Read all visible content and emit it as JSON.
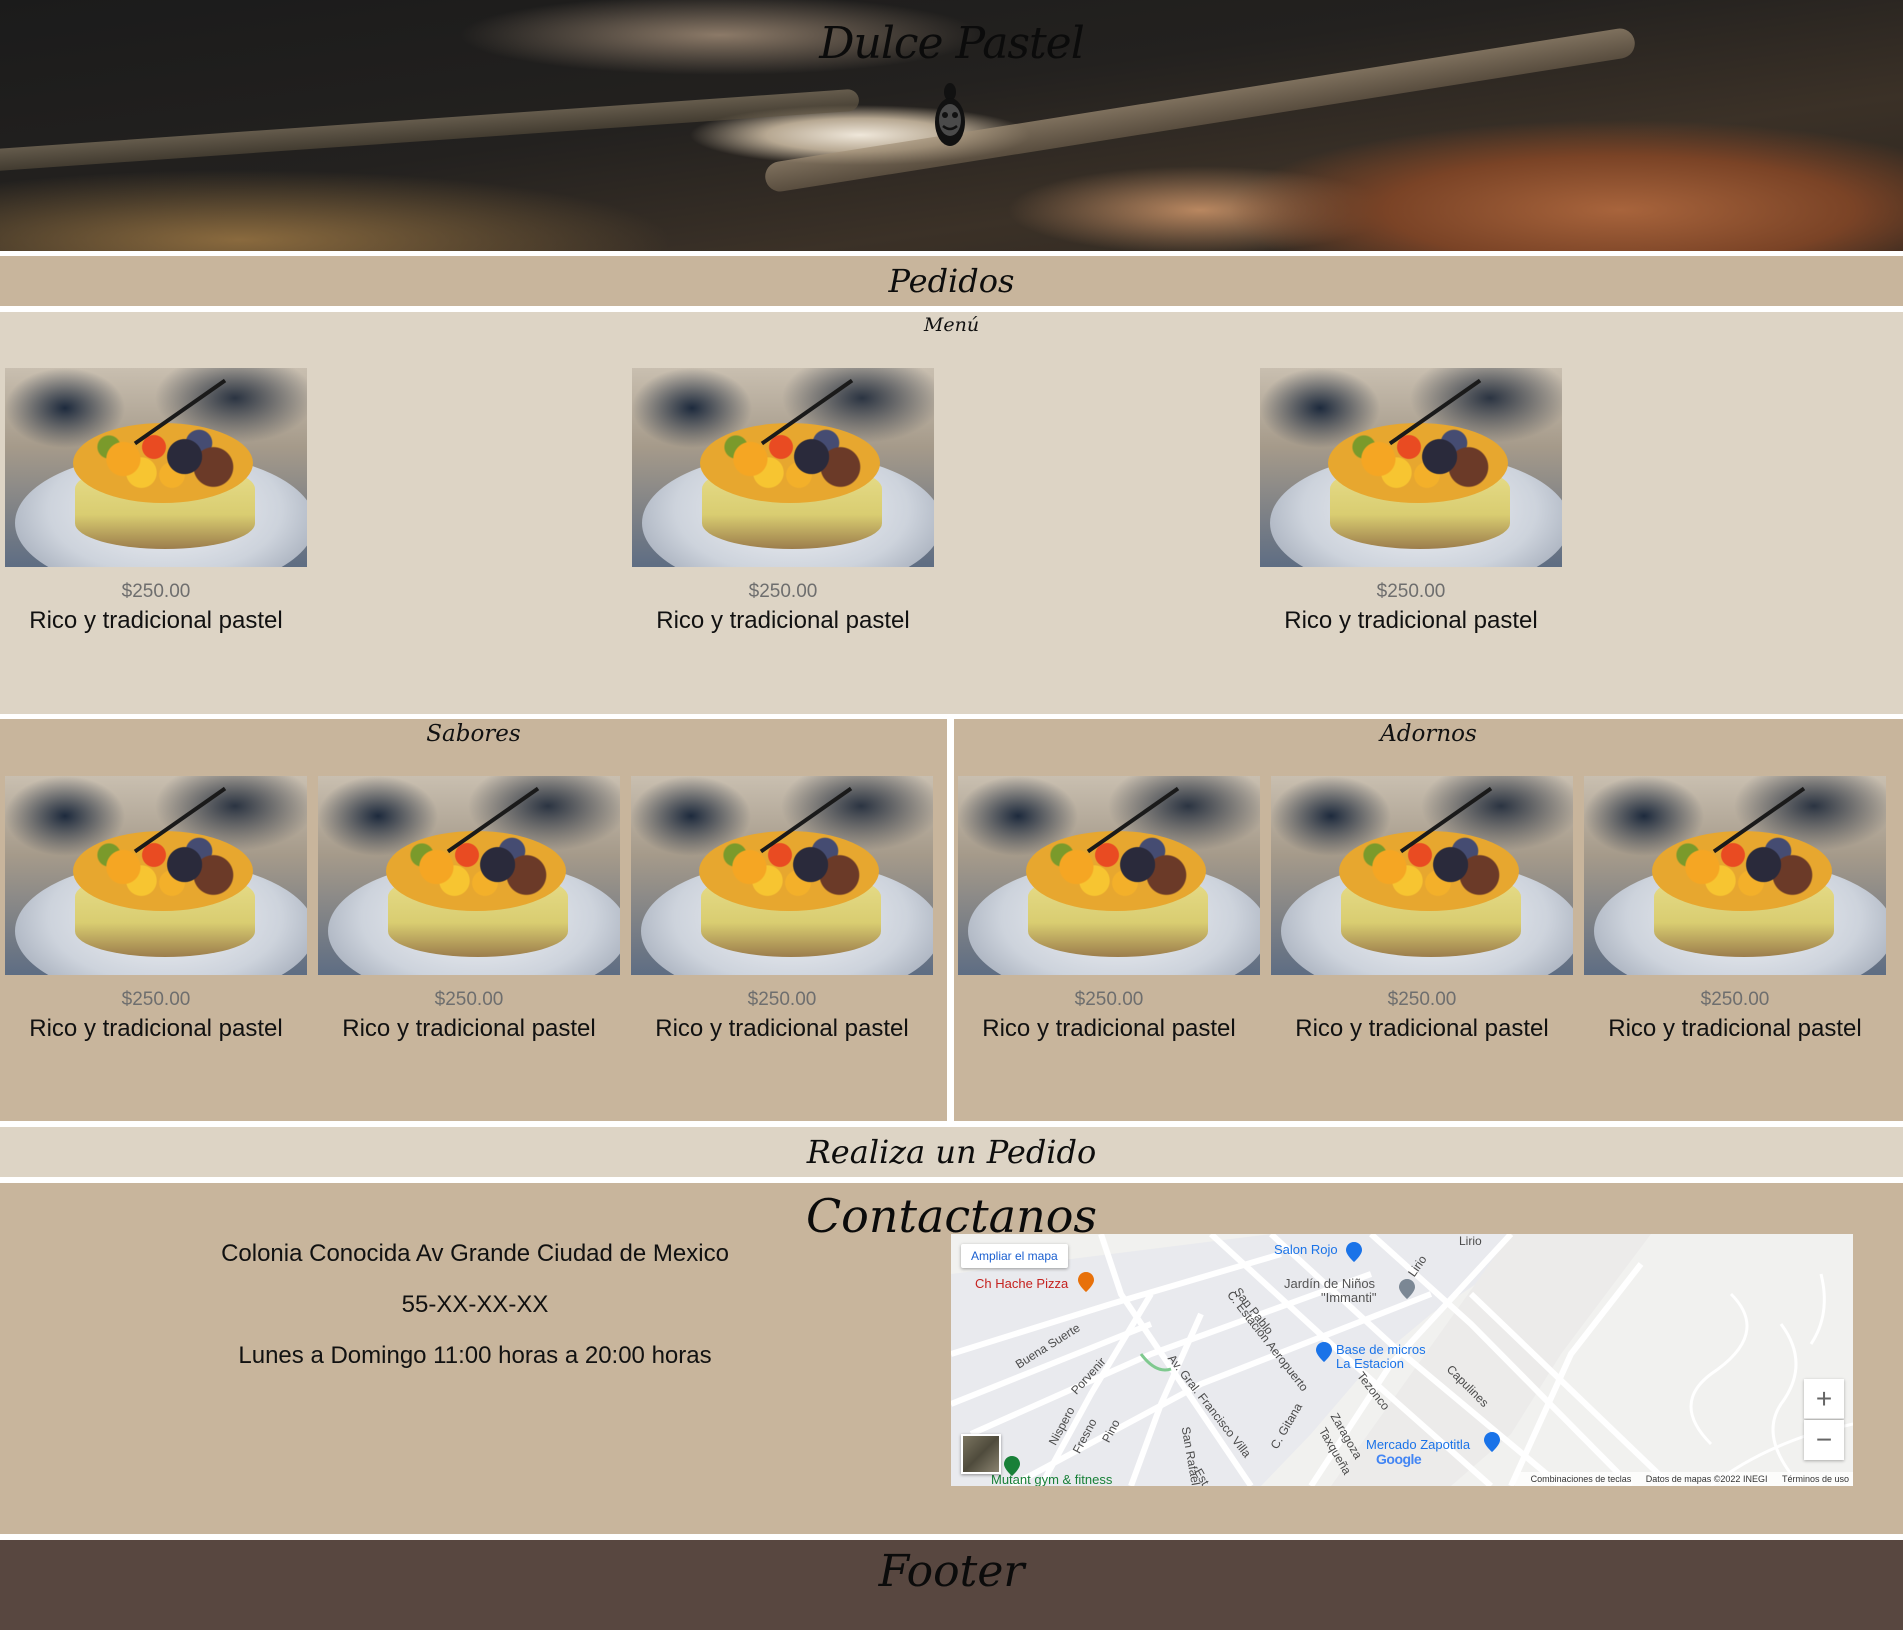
{
  "header": {
    "brand": "Dulce Pastel",
    "logo_icon": "cake-face-icon"
  },
  "pedidos_bar": {
    "label": "Pedidos"
  },
  "menu": {
    "title": "Menú",
    "items": [
      {
        "price": "$250.00",
        "description": "Rico y tradicional pastel"
      },
      {
        "price": "$250.00",
        "description": "Rico y tradicional pastel"
      },
      {
        "price": "$250.00",
        "description": "Rico y tradicional pastel"
      }
    ]
  },
  "sabores": {
    "title": "Sabores",
    "items": [
      {
        "price": "$250.00",
        "description": "Rico y tradicional pastel"
      },
      {
        "price": "$250.00",
        "description": "Rico y tradicional pastel"
      },
      {
        "price": "$250.00",
        "description": "Rico y tradicional pastel"
      }
    ]
  },
  "adornos": {
    "title": "Adornos",
    "items": [
      {
        "price": "$250.00",
        "description": "Rico y tradicional pastel"
      },
      {
        "price": "$250.00",
        "description": "Rico y tradicional pastel"
      },
      {
        "price": "$250.00",
        "description": "Rico y tradicional pastel"
      }
    ]
  },
  "realiza_bar": {
    "label": "Realiza un Pedido"
  },
  "contact": {
    "title": "Contactanos",
    "address": "Colonia Conocida Av Grande Ciudad de Mexico",
    "phone": "55-XX-XX-XX",
    "hours": "Lunes a Domingo 11:00 horas a 20:00 horas"
  },
  "map": {
    "enlarge_link": "Ampliar el mapa",
    "zoom_in": "+",
    "zoom_out": "−",
    "google_logo": "Google",
    "attribution": {
      "shortcuts": "Combinaciones de teclas",
      "data": "Datos de mapas ©2022 INEGI",
      "terms": "Términos de uso"
    },
    "pois": {
      "salon_rojo": "Salon Rojo",
      "ch_hache": "Ch Hache Pizza",
      "jardin_1": "Jardín de Niños",
      "jardin_2": "\"Immanti\"",
      "base_1": "Base de micros",
      "base_2": "La Estacion",
      "mercado": "Mercado Zapotitla",
      "mutant": "Mutant gym & fitness"
    },
    "streets": {
      "lirio": "Lirio",
      "lirio2": "Lirio",
      "san_pablo": "San Pablo",
      "estacion": "C. Estación Aeropuerto",
      "buena_suerte": "Buena Suerte",
      "porvenir": "Porvenir",
      "villa": "Av. Gral. Francisco Villa",
      "gitana": "C. Gitana",
      "tezonco": "Tezonco",
      "capulines": "Capulines",
      "nispero": "Nispero",
      "fresno": "Fresno",
      "pino": "Pino",
      "san_rafael": "San Rafael",
      "zaragoza": "Zaragoza",
      "taxquena": "Taxqueña",
      "est": "Est"
    },
    "colors": {
      "poi_red": "#d93025",
      "poi_orange": "#e8710a",
      "poi_blue": "#1a73e8",
      "poi_green": "#188038"
    }
  },
  "footer": {
    "label": "Footer"
  },
  "colors": {
    "tan": "#c8b59c",
    "light_tan": "#ddd4c5",
    "footer_brown": "#584740"
  }
}
